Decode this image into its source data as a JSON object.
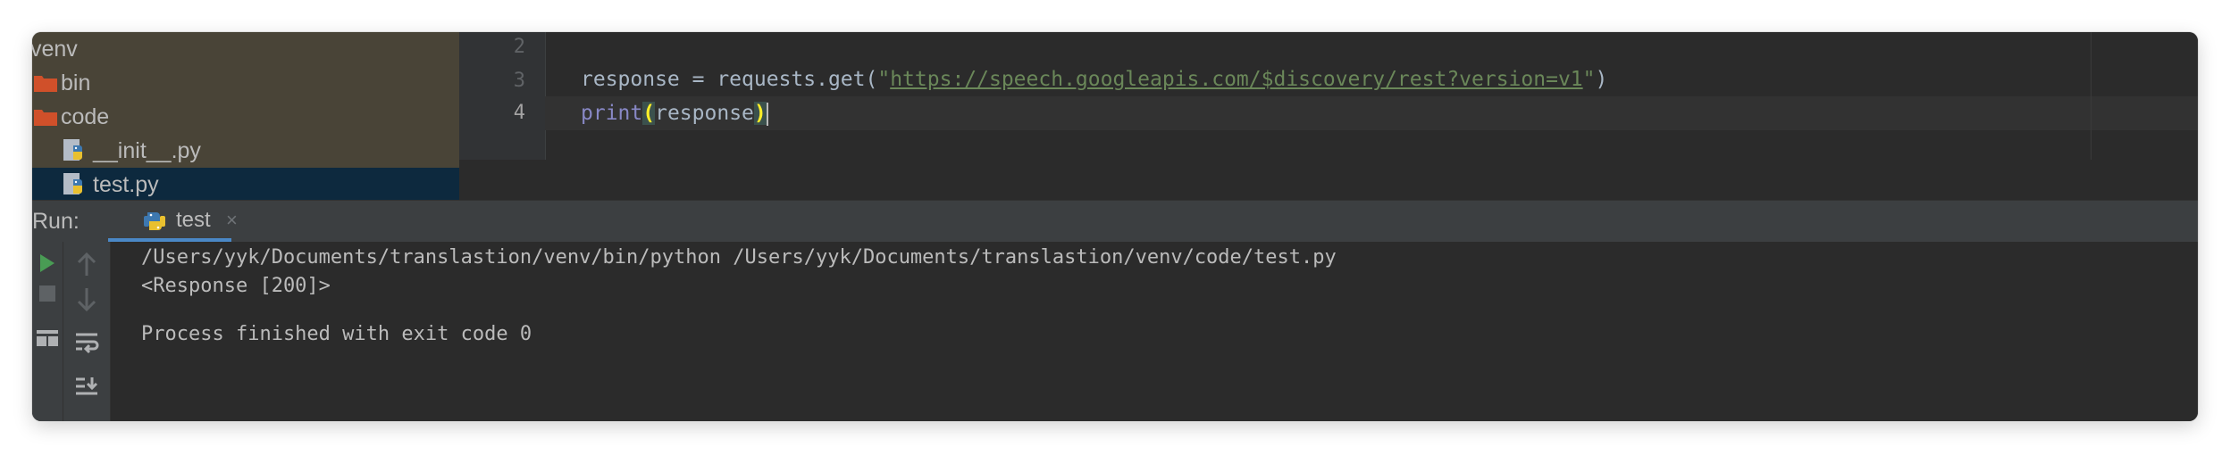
{
  "project_tree": {
    "items": [
      {
        "label": "venv",
        "type": "folder-root"
      },
      {
        "label": "bin",
        "type": "folder"
      },
      {
        "label": "code",
        "type": "folder"
      },
      {
        "label": "__init__.py",
        "type": "python-file"
      },
      {
        "label": "test.py",
        "type": "python-file",
        "selected": true
      }
    ]
  },
  "editor": {
    "line_numbers": [
      "2",
      "3",
      "4"
    ],
    "line3": {
      "var": "response",
      "assign": " = ",
      "call": "requests.get(",
      "quote_open": "\"",
      "url": "https://speech.googleapis.com/$discovery/rest?version=v1",
      "quote_close": "\"",
      "close": ")"
    },
    "line4": {
      "func": "print",
      "open_paren": "(",
      "arg": "response",
      "close_paren": ")"
    }
  },
  "run_panel": {
    "title": "Run:",
    "tab_label": "test",
    "tab_close": "×",
    "console": [
      "/Users/yyk/Documents/translastion/venv/bin/python /Users/yyk/Documents/translastion/venv/code/test.py",
      "<Response [200]>",
      "",
      "Process finished with exit code 0"
    ]
  },
  "colors": {
    "tree_bg": "#494437",
    "selection_bg": "#0d293e",
    "folder": "#d0502a",
    "editor_bg": "#2b2b2b",
    "string": "#6a8759",
    "builtin": "#8888c6",
    "run_icon": "#499c54",
    "tab_underline": "#4a88c7"
  },
  "icons": {
    "folder": "folder-icon",
    "python": "python-file-icon",
    "rerun": "rerun-icon",
    "stop": "stop-icon",
    "up": "arrow-up-icon",
    "down": "arrow-down-icon",
    "wrap": "soft-wrap-icon",
    "layout": "layout-icon",
    "scroll_end": "scroll-to-end-icon"
  }
}
